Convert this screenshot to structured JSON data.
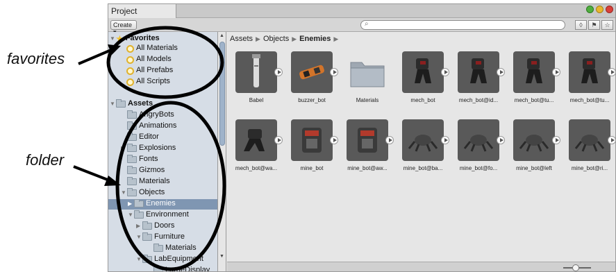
{
  "annotations": {
    "favorites_label": "favorites",
    "folder_label": "folder"
  },
  "window": {
    "tab_title": "Project",
    "toolbar": {
      "create_label": "Create ▾",
      "search_placeholder": ""
    }
  },
  "tree": {
    "favorites_header": "Favorites",
    "favorites": [
      "All Materials",
      "All Models",
      "All Prefabs",
      "All Scripts"
    ],
    "assets_header": "Assets",
    "folders": [
      {
        "label": "AngryBots"
      },
      {
        "label": "Animations"
      },
      {
        "label": "Editor"
      },
      {
        "label": "Explosions"
      },
      {
        "label": "Fonts"
      },
      {
        "label": "Gizmos"
      },
      {
        "label": "Materials"
      },
      {
        "label": "Objects"
      },
      {
        "label": "Enemies"
      },
      {
        "label": "Environment"
      },
      {
        "label": "Doors"
      },
      {
        "label": "Furniture"
      },
      {
        "label": "Materials"
      },
      {
        "label": "LabEquipment"
      },
      {
        "label": "LargeDisplay"
      }
    ]
  },
  "content": {
    "breadcrumb": [
      "Assets",
      "Objects",
      "Enemies"
    ],
    "assets": [
      {
        "label": "Babel"
      },
      {
        "label": "buzzer_bot"
      },
      {
        "label": "Materials"
      },
      {
        "label": "mech_bot"
      },
      {
        "label": "mech_bot@id..."
      },
      {
        "label": "mech_bot@tu..."
      },
      {
        "label": "mech_bot@tu..."
      },
      {
        "label": "mech_bot@wa..."
      },
      {
        "label": "mine_bot"
      },
      {
        "label": "mine_bot@aw..."
      },
      {
        "label": "mine_bot@ba..."
      },
      {
        "label": "mine_bot@fo..."
      },
      {
        "label": "mine_bot@left"
      },
      {
        "label": "mine_bot@ri..."
      }
    ]
  },
  "colors": {
    "tree_bg": "#d6dde6",
    "selection": "#7f96b2",
    "thumb_bg": "#595959"
  }
}
